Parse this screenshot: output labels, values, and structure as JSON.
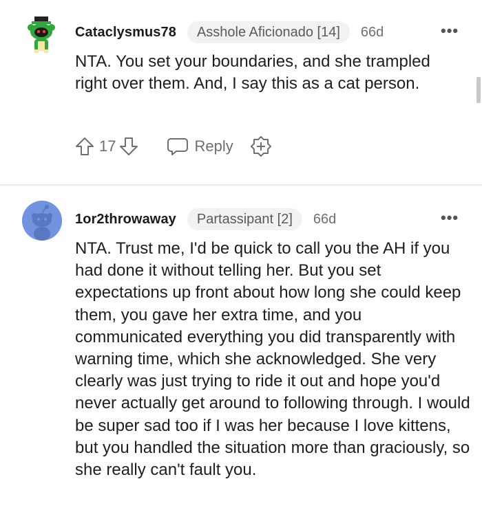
{
  "comments": [
    {
      "username": "Cataclysmus78",
      "flair": "Asshole Aficionado [14]",
      "age": "66d",
      "more": "•••",
      "body": "NTA. You set your boundaries, and she trampled right over them. And, I say this as a cat person.",
      "score": "17",
      "reply_label": "Reply",
      "avatar": "green-snoo-avatar"
    },
    {
      "username": "1or2throwaway",
      "flair": "Partassipant [2]",
      "age": "66d",
      "more": "•••",
      "body": "NTA. Trust me, I'd be quick to call you the AH if you had done it without telling her. But you set expectations up front about how long she could keep them, you gave her extra time, and you communicated everything you did transparently with warning time, which she acknowledged. She very clearly was just trying to ride it out and hope you'd never actually get around to following through. I would be super sad too if I was her because I love kittens, but you handled the situation more than graciously, so she really can't fault you.",
      "avatar": "default-snoo-avatar"
    }
  ],
  "colors": {
    "avatar_blue": "#7193e0",
    "avatar_green": "#2fa73a",
    "flair_bg": "#f2f2f2",
    "muted_text": "#6e6e6e"
  }
}
